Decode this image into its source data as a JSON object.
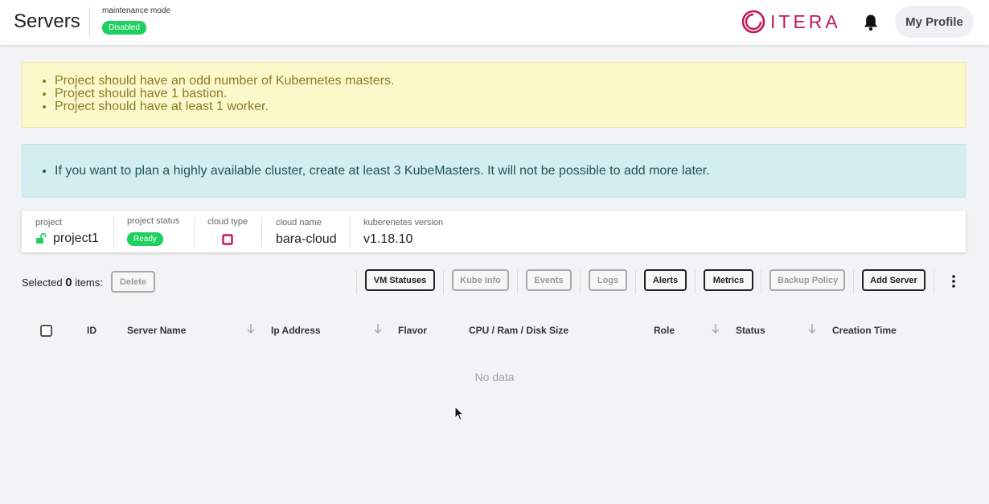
{
  "header": {
    "title": "Servers",
    "maintenance_label": "maintenance mode",
    "maintenance_status": "Disabled",
    "logo_text": "ITERA",
    "profile_button": "My Profile"
  },
  "alerts": {
    "warnings": [
      "Project should have an odd number of Kubernetes masters.",
      "Project should have 1 bastion.",
      "Project should have at least 1 worker."
    ],
    "info": [
      "If you want to plan a highly available cluster, create at least 3 KubeMasters. It will not be possible to add more later."
    ]
  },
  "project_info": {
    "project_label": "project",
    "project_value": "project1",
    "status_label": "project status",
    "status_value": "Ready",
    "cloud_type_label": "cloud type",
    "cloud_name_label": "cloud name",
    "cloud_name_value": "bara-cloud",
    "k8s_label": "kuberenetes version",
    "k8s_value": "v1.18.10"
  },
  "toolbar": {
    "selected_prefix": "Selected",
    "selected_count": "0",
    "selected_suffix": "items:",
    "delete": "Delete",
    "vm_statuses": "VM Statuses",
    "kube_info": "Kube Info",
    "events": "Events",
    "logs": "Logs",
    "alerts": "Alerts",
    "metrics": "Metrics",
    "backup_policy": "Backup Policy",
    "add_server": "Add Server"
  },
  "table": {
    "columns": {
      "id": "ID",
      "server_name": "Server Name",
      "ip_address": "Ip Address",
      "flavor": "Flavor",
      "cpu_ram_disk": "CPU / Ram / Disk Size",
      "role": "Role",
      "status": "Status",
      "creation_time": "Creation Time"
    },
    "empty_text": "No data"
  },
  "colors": {
    "accent_green": "#1fd05e",
    "brand": "#c2185b",
    "warning_bg": "#fbf9c9",
    "info_bg": "#d2eef0"
  }
}
